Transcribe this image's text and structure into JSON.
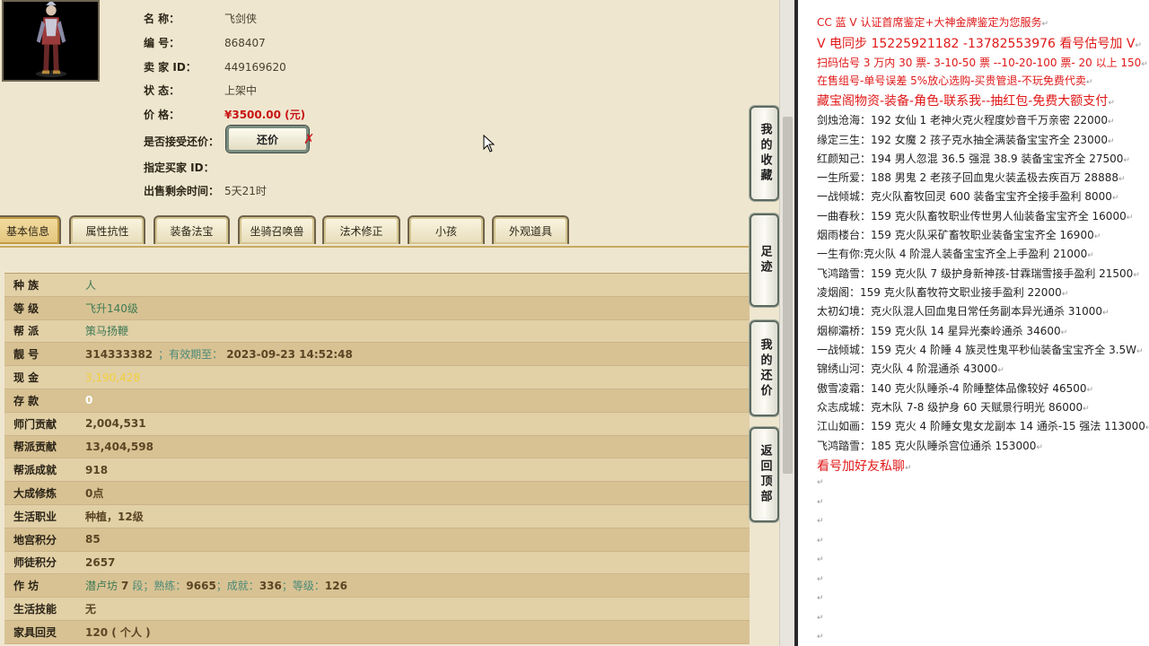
{
  "item": {
    "name_label": "名 称：",
    "name": "飞剑侠",
    "id_label": "编 号：",
    "id": "868407",
    "seller_label": "卖 家 ID：",
    "seller_id": "449169620",
    "status_label": "状 态：",
    "status": "上架中",
    "price_label": "价 格：",
    "price": "¥3500.00 (元)",
    "counter_label": "是否接受还价：",
    "counter_button": "还价",
    "counter_x": "✗",
    "buyer_label": "指定买家 ID：",
    "buyer": "",
    "remaining_label": "出售剩余时间：",
    "remaining": "5天21时"
  },
  "tabs": [
    "基本信息",
    "属性抗性",
    "装备法宝",
    "坐骑召唤兽",
    "法术修正",
    "小孩",
    "外观道具"
  ],
  "details": [
    {
      "label": "种 族",
      "value": "人"
    },
    {
      "label": "等 级",
      "value": "飞升140级"
    },
    {
      "label": "帮 派",
      "value": "策马扬鞭"
    },
    {
      "label": "靓 号",
      "value": "314333382",
      "extra_label": "有效期至：",
      "extra_value": "2023-09-23 14:52:48"
    },
    {
      "label": "现 金",
      "value": "3,190,428"
    },
    {
      "label": "存 款",
      "value": "0"
    },
    {
      "label": "师门贡献",
      "value": "2,004,531"
    },
    {
      "label": "帮派贡献",
      "value": "13,404,598"
    },
    {
      "label": "帮派成就",
      "value": "918"
    },
    {
      "label": "大成修炼",
      "value": "0点"
    },
    {
      "label": "生活职业",
      "value": "种植，12级"
    },
    {
      "label": "地宫积分",
      "value": "85"
    },
    {
      "label": "师徒积分",
      "value": "2657"
    },
    {
      "label": "作 坊",
      "value": "潜卢坊",
      "parts": [
        "7",
        "段；熟练：",
        "9665",
        "；成就：",
        "336",
        "；等级：",
        "126"
      ]
    },
    {
      "label": "生活技能",
      "value": "无"
    },
    {
      "label": "家具回灵",
      "value": "120 ( 个人 )"
    }
  ],
  "side_buttons": [
    "我的收藏",
    "足迹",
    "我的还价",
    "返回顶部"
  ],
  "right_panel": {
    "lines": [
      {
        "text": "CC 蓝 V 认证首席鉴定+大神金牌鉴定为您服务",
        "style": "red"
      },
      {
        "text": "V 电同步 15225921182 -13782553976 看号估号加 V",
        "style": "red big"
      },
      {
        "text": "扫码估号 3 万内 30 票- 3-10-50 票 --10-20-100 票- 20 以上 150",
        "style": "red"
      },
      {
        "text": "在售组号-单号误差 5%放心选购-买贵管退-不玩免费代卖",
        "style": "red"
      },
      {
        "text": "藏宝阁物资-装备-角色-联系我--抽红包-免费大额支付",
        "style": "red big"
      },
      {
        "text": "剑烛沧海：192 女仙 1 老神火克火程度妙音千万亲密 22000",
        "style": ""
      },
      {
        "text": "缘定三生：192 女魔 2 孩子克水抽全满装备宝宝齐全 23000",
        "style": ""
      },
      {
        "text": "红颜知己：194 男人忽混 36.5 强混 38.9 装备宝宝齐全 27500",
        "style": ""
      },
      {
        "text": "一生所爱：188 男鬼 2 老孩子回血鬼火装孟极去疾百万 28888",
        "style": ""
      },
      {
        "text": "一战倾城：克火队畜牧回灵 600 装备宝宝齐全接手盈利 8000",
        "style": ""
      },
      {
        "text": "一曲春秋：159 克火队畜牧职业传世男人仙装备宝宝齐全 16000",
        "style": ""
      },
      {
        "text": "烟雨楼台：159 克火队采矿畜牧职业装备宝宝齐全 16900",
        "style": ""
      },
      {
        "text": "一生有你:克火队 4 阶混人装备宝宝齐全上手盈利 21000",
        "style": ""
      },
      {
        "text": "飞鸿踏雪：159 克火队 7 级护身新神孩-甘霖瑞雪接手盈利 21500",
        "style": ""
      },
      {
        "text": "凌烟阁：159 克火队畜牧符文职业接手盈利 22000",
        "style": ""
      },
      {
        "text": "太初幻境：克火队混人回血鬼日常任务副本异光通杀 31000",
        "style": ""
      },
      {
        "text": "烟柳灞桥：159 克火队 14 星异光秦岭通杀 34600",
        "style": ""
      },
      {
        "text": "一战倾城：159 克火 4 阶睡 4 族灵性鬼平秒仙装备宝宝齐全 3.5W",
        "style": ""
      },
      {
        "text": "锦绣山河：克火队 4 阶混通杀 43000",
        "style": ""
      },
      {
        "text": "傲雪凌霜：140 克火队睡杀-4 阶睡整体品像较好 46500",
        "style": ""
      },
      {
        "text": "众志成城：克木队 7-8 级护身 60 天赋景行明光 86000",
        "style": ""
      },
      {
        "text": "江山如画：159 克火 4 阶睡女鬼女龙副本 14 通杀-15 强法 113000",
        "style": ""
      },
      {
        "text": "飞鸿踏雪：185 克火队睡杀宫位通杀 153000",
        "style": ""
      },
      {
        "text": "看号加好友私聊",
        "style": "red big"
      }
    ],
    "paragraph_mark": "↵"
  }
}
